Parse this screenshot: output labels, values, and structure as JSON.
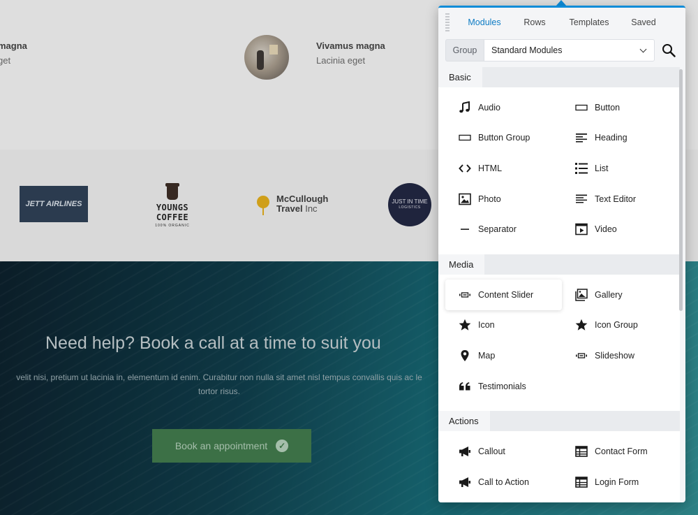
{
  "background": {
    "team": [
      {
        "name": "magna",
        "role": "get"
      },
      {
        "name": "Vivamus magna",
        "role": "Lacinia eget"
      }
    ],
    "logos": {
      "jett": "JETT AIRLINES",
      "youngs_line1": "YOUNGS COFFEE",
      "youngs_line2": "100% ORGANIC",
      "mcc_line1": "McCullough",
      "mcc_line2a": "Travel",
      "mcc_line2b": "Inc",
      "jit_line1": "JUST IN TIME",
      "jit_line2": "LOGISTICS"
    },
    "cta": {
      "title": "Need help? Book a call at a time to suit you",
      "body_line1": "velit nisi, pretium ut lacinia in, elementum id enim. Curabitur non nulla sit amet nisl tempus convallis quis ac le",
      "body_line2": "tortor risus.",
      "button": "Book an appointment"
    }
  },
  "panel": {
    "tabs": [
      {
        "label": "Modules",
        "active": true
      },
      {
        "label": "Rows",
        "active": false
      },
      {
        "label": "Templates",
        "active": false
      },
      {
        "label": "Saved",
        "active": false
      }
    ],
    "group_label": "Group",
    "group_value": "Standard Modules",
    "accent_color": "#0e8cd8",
    "sections": [
      {
        "title": "Basic",
        "modules": [
          {
            "label": "Audio",
            "icon": "music-note-icon"
          },
          {
            "label": "Button",
            "icon": "button-rect-icon"
          },
          {
            "label": "Button Group",
            "icon": "button-rect-icon"
          },
          {
            "label": "Heading",
            "icon": "heading-lines-icon"
          },
          {
            "label": "HTML",
            "icon": "code-brackets-icon"
          },
          {
            "label": "List",
            "icon": "list-icon"
          },
          {
            "label": "Photo",
            "icon": "photo-icon"
          },
          {
            "label": "Text Editor",
            "icon": "text-editor-icon"
          },
          {
            "label": "Separator",
            "icon": "separator-icon"
          },
          {
            "label": "Video",
            "icon": "video-icon"
          }
        ]
      },
      {
        "title": "Media",
        "modules": [
          {
            "label": "Content Slider",
            "icon": "slider-icon",
            "active": true
          },
          {
            "label": "Gallery",
            "icon": "gallery-icon"
          },
          {
            "label": "Icon",
            "icon": "star-icon"
          },
          {
            "label": "Icon Group",
            "icon": "star-icon"
          },
          {
            "label": "Map",
            "icon": "map-pin-icon"
          },
          {
            "label": "Slideshow",
            "icon": "slider-icon"
          },
          {
            "label": "Testimonials",
            "icon": "quote-icon"
          }
        ]
      },
      {
        "title": "Actions",
        "modules": [
          {
            "label": "Callout",
            "icon": "megaphone-icon"
          },
          {
            "label": "Contact Form",
            "icon": "form-table-icon"
          },
          {
            "label": "Call to Action",
            "icon": "megaphone-icon"
          },
          {
            "label": "Login Form",
            "icon": "form-table-icon"
          }
        ]
      }
    ]
  }
}
